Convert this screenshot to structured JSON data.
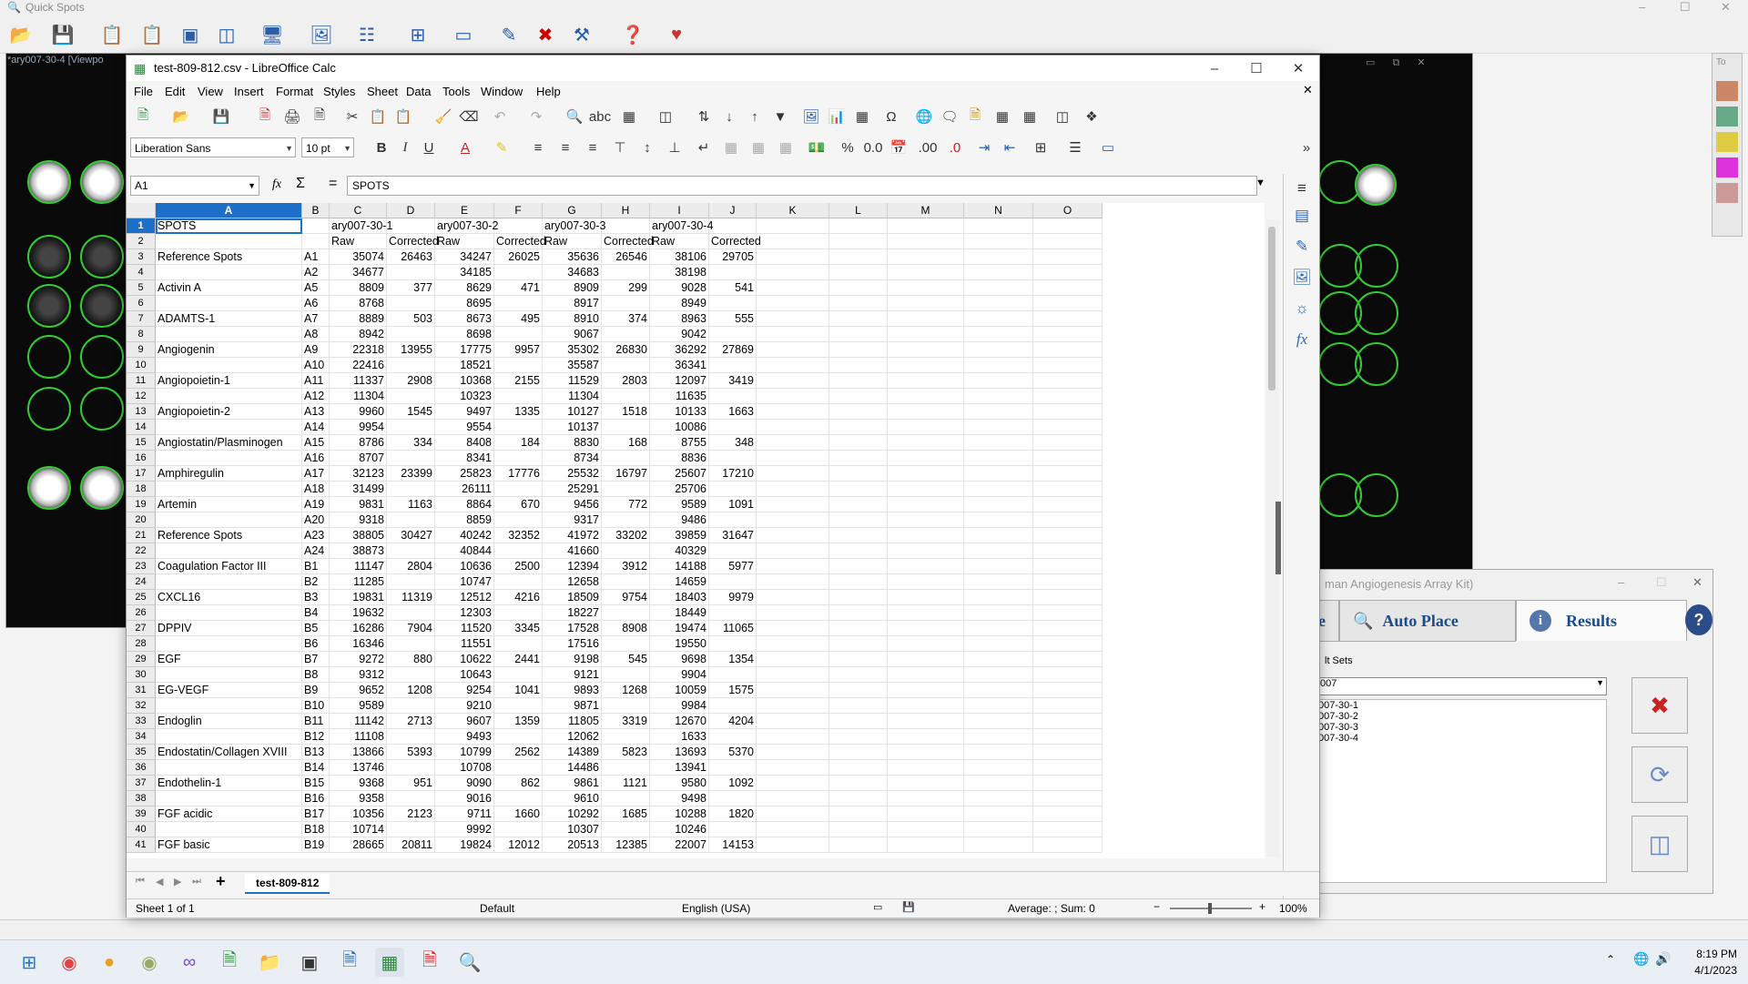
{
  "quickspots": {
    "title": "Quick Spots",
    "viewport_title": "*ary007-30-4 [Viewpo",
    "dialog": {
      "title": "man Angiogenesis Array Kit)",
      "tab_place": "e",
      "tab_auto": "Auto Place",
      "tab_results": "Results",
      "sets_label": "lt Sets",
      "select_value": "007",
      "list": [
        "007-30-1",
        "007-30-2",
        "007-30-3",
        "007-30-4"
      ]
    }
  },
  "calc": {
    "title": "test-809-812.csv - LibreOffice Calc",
    "menus": [
      "File",
      "Edit",
      "View",
      "Insert",
      "Format",
      "Styles",
      "Sheet",
      "Data",
      "Tools",
      "Window",
      "Help"
    ],
    "font_name": "Liberation Sans",
    "font_size": "10 pt",
    "name_box": "A1",
    "formula": "SPOTS",
    "columns": [
      "A",
      "B",
      "C",
      "D",
      "E",
      "F",
      "G",
      "H",
      "I",
      "J",
      "K",
      "L",
      "M",
      "N",
      "O"
    ],
    "rows": [
      [
        "SPOTS",
        "",
        "ary007-30-1",
        "",
        "ary007-30-2",
        "",
        "ary007-30-3",
        "",
        "ary007-30-4",
        ""
      ],
      [
        "",
        "",
        "Raw",
        "Corrected",
        "Raw",
        "Corrected",
        "Raw",
        "Corrected",
        "Raw",
        "Corrected"
      ],
      [
        "Reference Spots",
        "A1",
        "35074",
        "26463",
        "34247",
        "26025",
        "35636",
        "26546",
        "38106",
        "29705"
      ],
      [
        "",
        "A2",
        "34677",
        "",
        "34185",
        "",
        "34683",
        "",
        "38198",
        ""
      ],
      [
        "Activin A",
        "A5",
        "8809",
        "377",
        "8629",
        "471",
        "8909",
        "299",
        "9028",
        "541"
      ],
      [
        "",
        "A6",
        "8768",
        "",
        "8695",
        "",
        "8917",
        "",
        "8949",
        ""
      ],
      [
        "ADAMTS-1",
        "A7",
        "8889",
        "503",
        "8673",
        "495",
        "8910",
        "374",
        "8963",
        "555"
      ],
      [
        "",
        "A8",
        "8942",
        "",
        "8698",
        "",
        "9067",
        "",
        "9042",
        ""
      ],
      [
        "Angiogenin",
        "A9",
        "22318",
        "13955",
        "17775",
        "9957",
        "35302",
        "26830",
        "36292",
        "27869"
      ],
      [
        "",
        "A10",
        "22416",
        "",
        "18521",
        "",
        "35587",
        "",
        "36341",
        ""
      ],
      [
        "Angiopoietin-1",
        "A11",
        "11337",
        "2908",
        "10368",
        "2155",
        "11529",
        "2803",
        "12097",
        "3419"
      ],
      [
        "",
        "A12",
        "11304",
        "",
        "10323",
        "",
        "11304",
        "",
        "11635",
        ""
      ],
      [
        "Angiopoietin-2",
        "A13",
        "9960",
        "1545",
        "9497",
        "1335",
        "10127",
        "1518",
        "10133",
        "1663"
      ],
      [
        "",
        "A14",
        "9954",
        "",
        "9554",
        "",
        "10137",
        "",
        "10086",
        ""
      ],
      [
        "Angiostatin/Plasminogen",
        "A15",
        "8786",
        "334",
        "8408",
        "184",
        "8830",
        "168",
        "8755",
        "348"
      ],
      [
        "",
        "A16",
        "8707",
        "",
        "8341",
        "",
        "8734",
        "",
        "8836",
        ""
      ],
      [
        "Amphiregulin",
        "A17",
        "32123",
        "23399",
        "25823",
        "17776",
        "25532",
        "16797",
        "25607",
        "17210"
      ],
      [
        "",
        "A18",
        "31499",
        "",
        "26111",
        "",
        "25291",
        "",
        "25706",
        ""
      ],
      [
        "Artemin",
        "A19",
        "9831",
        "1163",
        "8864",
        "670",
        "9456",
        "772",
        "9589",
        "1091"
      ],
      [
        "",
        "A20",
        "9318",
        "",
        "8859",
        "",
        "9317",
        "",
        "9486",
        ""
      ],
      [
        "Reference Spots",
        "A23",
        "38805",
        "30427",
        "40242",
        "32352",
        "41972",
        "33202",
        "39859",
        "31647"
      ],
      [
        "",
        "A24",
        "38873",
        "",
        "40844",
        "",
        "41660",
        "",
        "40329",
        ""
      ],
      [
        "Coagulation Factor III",
        "B1",
        "11147",
        "2804",
        "10636",
        "2500",
        "12394",
        "3912",
        "14188",
        "5977"
      ],
      [
        "",
        "B2",
        "11285",
        "",
        "10747",
        "",
        "12658",
        "",
        "14659",
        ""
      ],
      [
        "CXCL16",
        "B3",
        "19831",
        "11319",
        "12512",
        "4216",
        "18509",
        "9754",
        "18403",
        "9979"
      ],
      [
        "",
        "B4",
        "19632",
        "",
        "12303",
        "",
        "18227",
        "",
        "18449",
        ""
      ],
      [
        "DPPIV",
        "B5",
        "16286",
        "7904",
        "11520",
        "3345",
        "17528",
        "8908",
        "19474",
        "11065"
      ],
      [
        "",
        "B6",
        "16346",
        "",
        "11551",
        "",
        "17516",
        "",
        "19550",
        ""
      ],
      [
        "EGF",
        "B7",
        "9272",
        "880",
        "10622",
        "2441",
        "9198",
        "545",
        "9698",
        "1354"
      ],
      [
        "",
        "B8",
        "9312",
        "",
        "10643",
        "",
        "9121",
        "",
        "9904",
        ""
      ],
      [
        "EG-VEGF",
        "B9",
        "9652",
        "1208",
        "9254",
        "1041",
        "9893",
        "1268",
        "10059",
        "1575"
      ],
      [
        "",
        "B10",
        "9589",
        "",
        "9210",
        "",
        "9871",
        "",
        "9984",
        ""
      ],
      [
        "Endoglin",
        "B11",
        "11142",
        "2713",
        "9607",
        "1359",
        "11805",
        "3319",
        "12670",
        "4204"
      ],
      [
        "",
        "B12",
        "11108",
        "",
        "9493",
        "",
        "12062",
        "",
        "1633",
        ""
      ],
      [
        "Endostatin/Collagen XVIII",
        "B13",
        "13866",
        "5393",
        "10799",
        "2562",
        "14389",
        "5823",
        "13693",
        "5370"
      ],
      [
        "",
        "B14",
        "13746",
        "",
        "10708",
        "",
        "14486",
        "",
        "13941",
        ""
      ],
      [
        "Endothelin-1",
        "B15",
        "9368",
        "951",
        "9090",
        "862",
        "9861",
        "1121",
        "9580",
        "1092"
      ],
      [
        "",
        "B16",
        "9358",
        "",
        "9016",
        "",
        "9610",
        "",
        "9498",
        ""
      ],
      [
        "FGF acidic",
        "B17",
        "10356",
        "2123",
        "9711",
        "1660",
        "10292",
        "1685",
        "10288",
        "1820"
      ],
      [
        "",
        "B18",
        "10714",
        "",
        "9992",
        "",
        "10307",
        "",
        "10246",
        ""
      ],
      [
        "FGF basic",
        "B19",
        "28665",
        "20811",
        "19824",
        "12012",
        "20513",
        "12385",
        "22007",
        "14153"
      ]
    ],
    "sheet_tab": "test-809-812",
    "status": {
      "sheet": "Sheet 1 of 1",
      "style": "Default",
      "language": "English (USA)",
      "summary": "Average: ; Sum: 0",
      "zoom": "100%"
    }
  },
  "taskbar": {
    "time": "8:19 PM",
    "date": "4/1/2023"
  }
}
